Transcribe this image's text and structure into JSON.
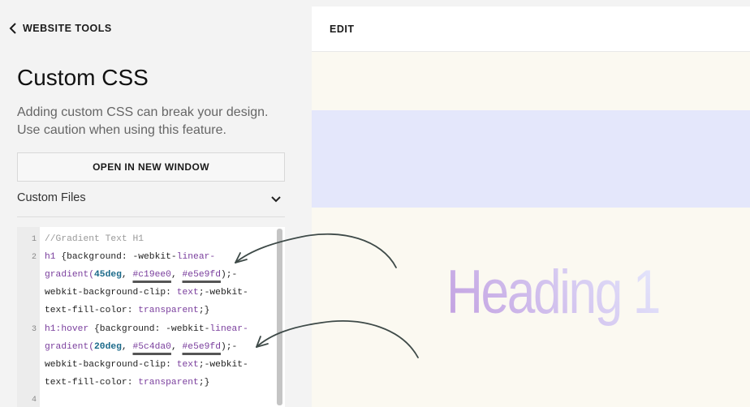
{
  "nav": {
    "back_label": "WEBSITE TOOLS"
  },
  "page": {
    "title": "Custom CSS",
    "warning": "Adding custom CSS can break your design. Use caution when using this feature.",
    "open_button": "OPEN IN NEW WINDOW",
    "custom_files_label": "Custom Files"
  },
  "editor": {
    "line_numbers": [
      "1",
      "2",
      "3",
      "4"
    ],
    "line1": "//Gradient Text H1",
    "line2": {
      "sel": "h1",
      "r1a": " {background: -webkit-",
      "kw1": "linear-",
      "r2a": "gradient(",
      "deg": "45deg",
      "sep1": ", ",
      "hex1": "#c19ee0",
      "sep2": ", ",
      "hex2": "#e5e9fd",
      "r2b": ");-",
      "r3a": "webkit-background-clip: ",
      "kw2": "text",
      "r3b": ";-webkit-",
      "r4a": "text-fill-color: ",
      "kw3": "transparent",
      "r4b": ";}"
    },
    "line3": {
      "sel": "h1:hover",
      "r1a": " {background: -webkit-",
      "kw1": "linear-",
      "r2a": "gradient(",
      "deg": "20deg",
      "sep1": ", ",
      "hex1": "#5c4da0",
      "sep2": ", ",
      "hex2": "#e5e9fd",
      "r2b": ");-",
      "r3a": "webkit-background-clip: ",
      "kw2": "text",
      "r3b": ";-webkit-",
      "r4a": "text-fill-color: ",
      "kw3": "transparent",
      "r4b": ";}"
    }
  },
  "preview": {
    "edit_label": "EDIT",
    "heading": "Heading 1"
  },
  "colors": {
    "gradient_start": "#c19ee0",
    "gradient_end": "#e5e9fd",
    "band": "#e4e7fb",
    "preview_bg": "#fbf9f1"
  },
  "icons": {
    "back": "chevron-left-icon",
    "files_toggle": "chevron-down-icon"
  }
}
